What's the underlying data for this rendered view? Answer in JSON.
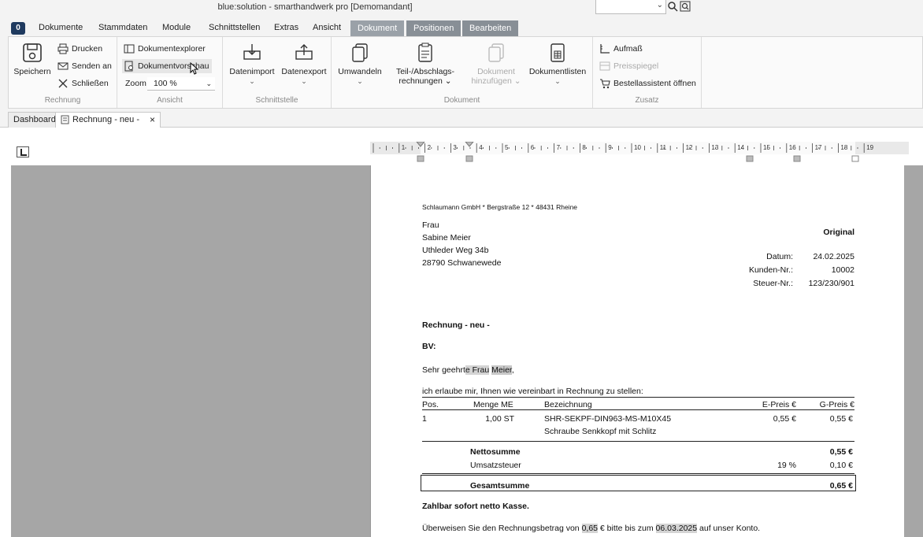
{
  "window": {
    "title": "blue:solution - smarthandwerk pro [Demomandant]"
  },
  "menu": {
    "app_button": "0",
    "items": [
      "Dokumente",
      "Stammdaten",
      "Module",
      "Schnittstellen",
      "Extras",
      "Ansicht"
    ],
    "context_tabs": [
      "Dokument",
      "Positionen",
      "Bearbeiten"
    ]
  },
  "ribbon": {
    "rechnung": {
      "label": "Rechnung",
      "save": "Speichern",
      "print": "Drucken",
      "send": "Senden an",
      "close": "Schließen"
    },
    "ansicht": {
      "label": "Ansicht",
      "explorer": "Dokumentexplorer",
      "preview": "Dokumentvorschau",
      "zoom_label": "Zoom",
      "zoom_value": "100 %"
    },
    "schnittstelle": {
      "label": "Schnittstelle",
      "import": "Datenimport",
      "export": "Datenexport"
    },
    "dokument": {
      "label": "Dokument",
      "convert": "Umwandeln",
      "partial_1": "Teil-/Abschlags-",
      "partial_2": "rechnungen",
      "add_1": "Dokument",
      "add_2": "hinzufügen",
      "lists": "Dokumentlisten"
    },
    "zusatz": {
      "label": "Zusatz",
      "aufmass": "Aufmaß",
      "preisspiegel": "Preisspiegel",
      "bestell": "Bestellassistent öffnen"
    }
  },
  "tabs": {
    "dashboard": "Dashboard",
    "current": "Rechnung - neu -",
    "close": "×"
  },
  "ruler": {
    "numbers": [
      "1",
      "2",
      "3",
      "4",
      "5",
      "6",
      "7",
      "8",
      "9",
      "10",
      "11",
      "12",
      "13",
      "14",
      "15",
      "16",
      "17",
      "18",
      "19"
    ]
  },
  "document": {
    "sender_line": "Schlaumann GmbH * Bergstraße 12 * 48431 Rheine",
    "recipient": [
      "Frau",
      "Sabine Meier",
      "Uthleder Weg 34b",
      "28790 Schwanewede"
    ],
    "copy_label": "Original",
    "meta": [
      {
        "label": "Datum:",
        "value": "24.02.2025"
      },
      {
        "label": "Kunden-Nr.:",
        "value": "10002"
      },
      {
        "label": "Steuer-Nr.:",
        "value": "123/230/901"
      }
    ],
    "heading": "Rechnung - neu -",
    "bv": "BV:",
    "salutation_pre": "Sehr geehrt",
    "salutation_hl1": "e Frau",
    "salutation_hl2": "Meier",
    "salutation_post": ",",
    "intro": "ich erlaube mir, Ihnen wie vereinbart in Rechnung zu stellen:",
    "table": {
      "headers": {
        "pos": "Pos.",
        "qty": "Menge ME",
        "desc": "Bezeichnung",
        "unit": "E-Preis €",
        "total": "G-Preis €"
      },
      "rows": [
        {
          "pos": "1",
          "qty": "1,00 ST",
          "desc": "SHR-SEKPF-DIN963-MS-M10X45",
          "desc2": "Schraube Senkkopf mit Schlitz",
          "unit": "0,55 €",
          "total": "0,55 €"
        }
      ]
    },
    "net_label": "Nettosumme",
    "net_value": "0,55 €",
    "vat_label": "Umsatzsteuer",
    "vat_rate": "19 %",
    "vat_value": "0,10 €",
    "gross_label": "Gesamtsumme",
    "gross_value": "0,65 €",
    "terms": "Zahlbar sofort netto Kasse.",
    "transfer_pre": "Überweisen Sie den Rechnungsbetrag von",
    "transfer_amount": "0,65",
    "transfer_mid": "€ bitte bis zum",
    "transfer_date": "06.03.2025",
    "transfer_post": "auf unser Konto."
  }
}
